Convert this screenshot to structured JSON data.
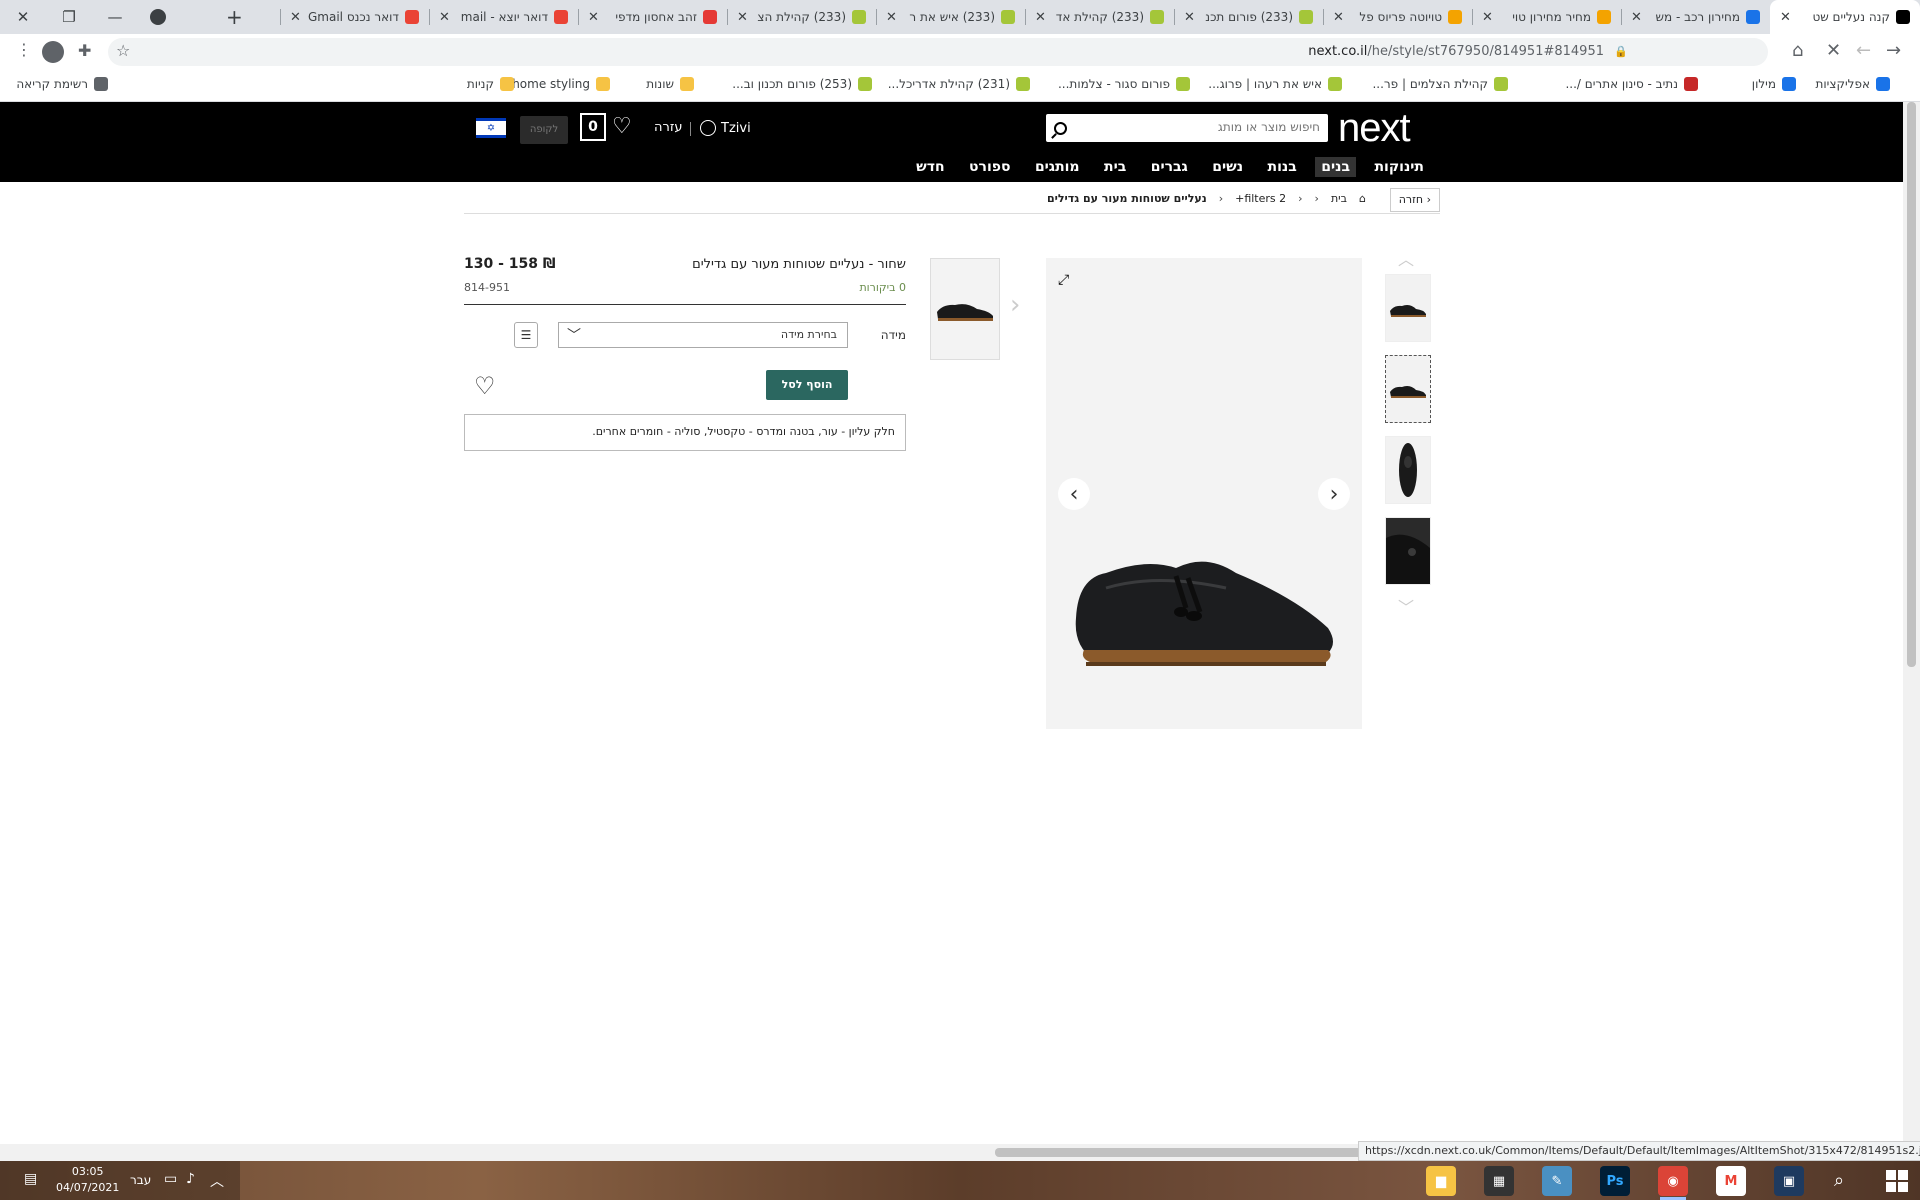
{
  "browser": {
    "tabs": [
      {
        "title": "קנה נעליים שט",
        "favicon_color": "#000000",
        "active": true
      },
      {
        "title": "מחירון רכב - מש",
        "favicon_color": "#1a73e8"
      },
      {
        "title": "מחיר מחירון טוי",
        "favicon_color": "#f4a300"
      },
      {
        "title": "טויוטה פריוס פל",
        "favicon_color": "#f4a300"
      },
      {
        "title": "(233) פורום תכנ",
        "favicon_color": "#a4c639"
      },
      {
        "title": "(233) קהילת אד",
        "favicon_color": "#a4c639"
      },
      {
        "title": "(233) איש את ר",
        "favicon_color": "#a4c639"
      },
      {
        "title": "(233) קהילת הצ",
        "favicon_color": "#a4c639"
      },
      {
        "title": "זהב אחסון מדפי",
        "favicon_color": "#e53935"
      },
      {
        "title": "דואר יוצא - mail",
        "favicon_color": "#ea4335"
      },
      {
        "title": "דואר נכנס Gmail",
        "favicon_color": "#ea4335"
      }
    ],
    "url_host": "next.co.il",
    "url_path": "/he/style/st767950/814951#814951",
    "bookmarks": [
      {
        "label": "אפליקציות",
        "icon_color": "#1a73e8"
      },
      {
        "label": "מילון",
        "icon_color": "#1a73e8"
      },
      {
        "label": "נתיב - סינון אתרים /...",
        "icon_color": "#c62828"
      },
      {
        "label": "קהילת הצלמים | פר...",
        "icon_color": "#a4c639"
      },
      {
        "label": "איש את רעהו | פרוג...",
        "icon_color": "#a4c639"
      },
      {
        "label": "פורום סגור - צלמות...",
        "icon_color": "#a4c639"
      },
      {
        "label": "(231) קהילת אדריכל...",
        "icon_color": "#a4c639"
      },
      {
        "label": "(253) פורום תכנון וב...",
        "icon_color": "#a4c639"
      },
      {
        "label": "שונות",
        "icon_color": "#f6c344"
      },
      {
        "label": "home styling",
        "icon_color": "#f6c344"
      },
      {
        "label": "קניות",
        "icon_color": "#f6c344"
      },
      {
        "label": "רשימת קריאה",
        "icon_color": "#5f6368"
      }
    ]
  },
  "site": {
    "logo": "next",
    "search_placeholder": "חיפוש מוצר או מותג",
    "user_name": "Tzivi",
    "help_label": "עזרה",
    "bag_count": "0",
    "checkout_label": "לקופה",
    "nav": [
      {
        "label": "תינוקות"
      },
      {
        "label": "בנים"
      },
      {
        "label": "בנות"
      },
      {
        "label": "נשים"
      },
      {
        "label": "גברים"
      },
      {
        "label": "בית"
      },
      {
        "label": "מותגים"
      },
      {
        "label": "ספורט"
      },
      {
        "label": "חדש"
      }
    ]
  },
  "breadcrumb": {
    "back_label": "חזרה",
    "items": [
      "בית",
      "filters 2+"
    ],
    "current": "נעליים שטוחות מעור עם גדילים"
  },
  "product": {
    "title": "שחור - נעליים שטוחות מעור עם גדילים",
    "price": "130 - 158 ₪",
    "reviews": "0 ביקורות",
    "sku": "814-951",
    "size_label": "מידה",
    "size_placeholder": "בחירת מידה",
    "add_to_bag": "הוסף לסל",
    "description": "חלק עליון - עור, בטנה ומדרס - טקסטיל, סוליה - חומרים אחרים."
  },
  "status_url": "https://xcdn.next.co.uk/Common/Items/Default/Default/ItemImages/AltItemShot/315x472/814951s2.jpg",
  "taskbar": {
    "time": "03:05",
    "date": "04/07/2021",
    "lang": "עבר"
  },
  "colors": {
    "accent": "#2b6760",
    "header_bg": "#000000"
  }
}
